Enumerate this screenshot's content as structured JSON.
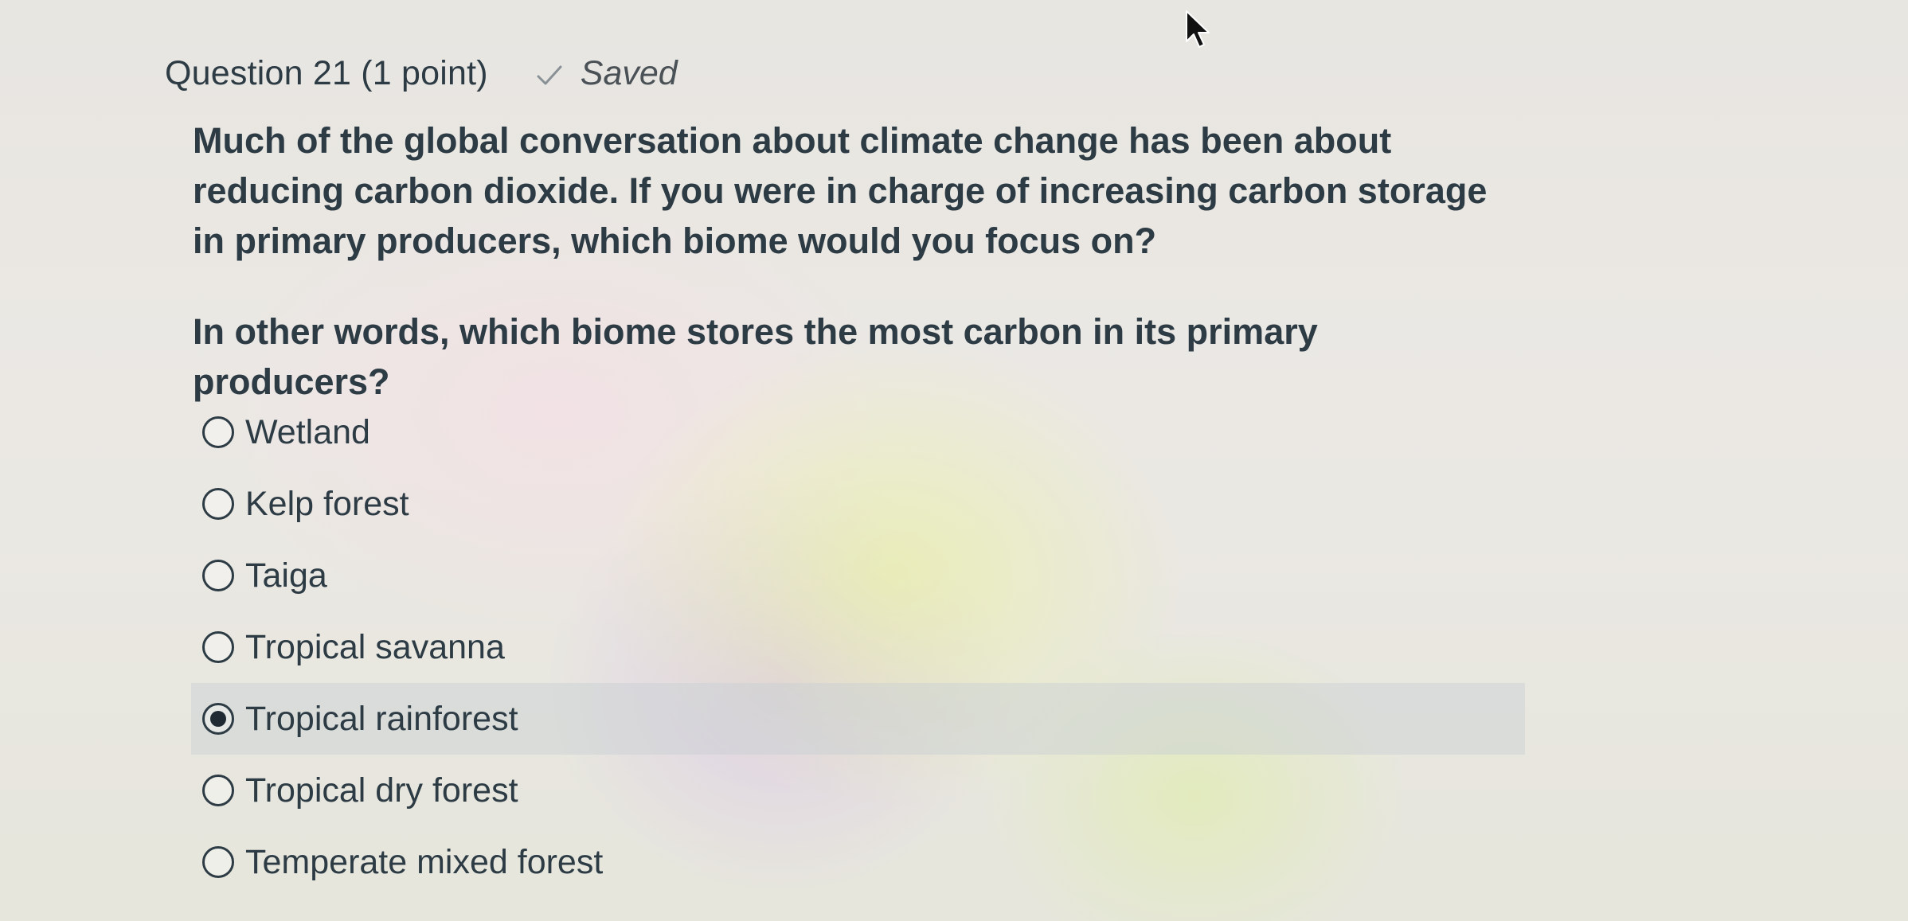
{
  "question": {
    "title": "Question 21 (1 point)",
    "status": "Saved",
    "status_icon": "check-icon",
    "prompt": "Much of the global conversation about climate change has been about reducing carbon dioxide. If you were in charge of increasing carbon storage in primary producers, which biome would you focus on?",
    "prompt_rephrased": "In other words, which biome stores the most carbon in its primary producers?"
  },
  "options": [
    {
      "label": "Wetland",
      "selected": false
    },
    {
      "label": "Kelp forest",
      "selected": false
    },
    {
      "label": "Taiga",
      "selected": false
    },
    {
      "label": "Tropical savanna",
      "selected": false
    },
    {
      "label": "Tropical rainforest",
      "selected": true
    },
    {
      "label": "Tropical dry forest",
      "selected": false
    },
    {
      "label": "Temperate mixed forest",
      "selected": false
    }
  ]
}
